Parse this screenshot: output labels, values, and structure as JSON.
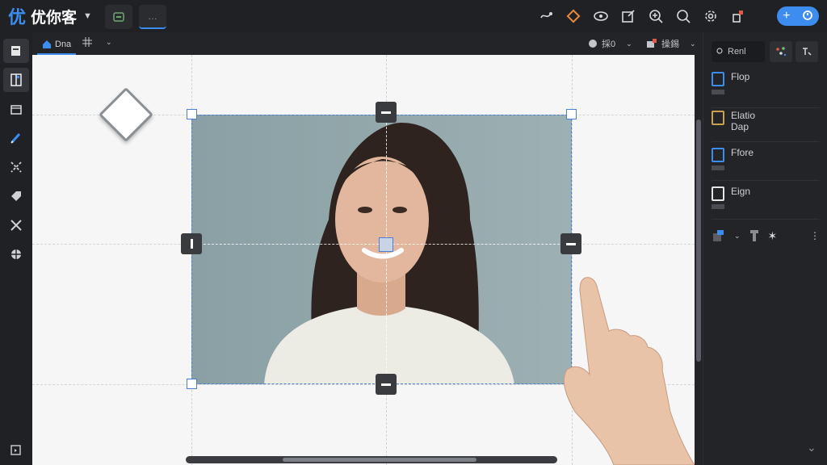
{
  "app": {
    "logo_mark": "优",
    "logo_text": "优你客",
    "tabs": [
      "",
      "…"
    ]
  },
  "topbar": {
    "icons": [
      "swap-icon",
      "palette-icon",
      "eye-icon",
      "edit-icon",
      "zoom-in-icon",
      "search-icon",
      "settings-icon",
      "layers-icon"
    ],
    "primary_button_icons": [
      "plus-icon",
      "pin-icon"
    ]
  },
  "subbar": {
    "active_tab": "Dna",
    "item2_label": "採0",
    "item3_label": "操錫"
  },
  "right_panel": {
    "search_placeholder": "Renl",
    "items": [
      {
        "label": "Flop"
      },
      {
        "label": "Elatio Dap"
      },
      {
        "label": "Ffore"
      },
      {
        "label": "Eign"
      }
    ]
  },
  "colors": {
    "accent": "#3d8df0",
    "background": "#1c1d20",
    "canvas": "#f6f6f6",
    "selection": "#4a7fd1"
  }
}
